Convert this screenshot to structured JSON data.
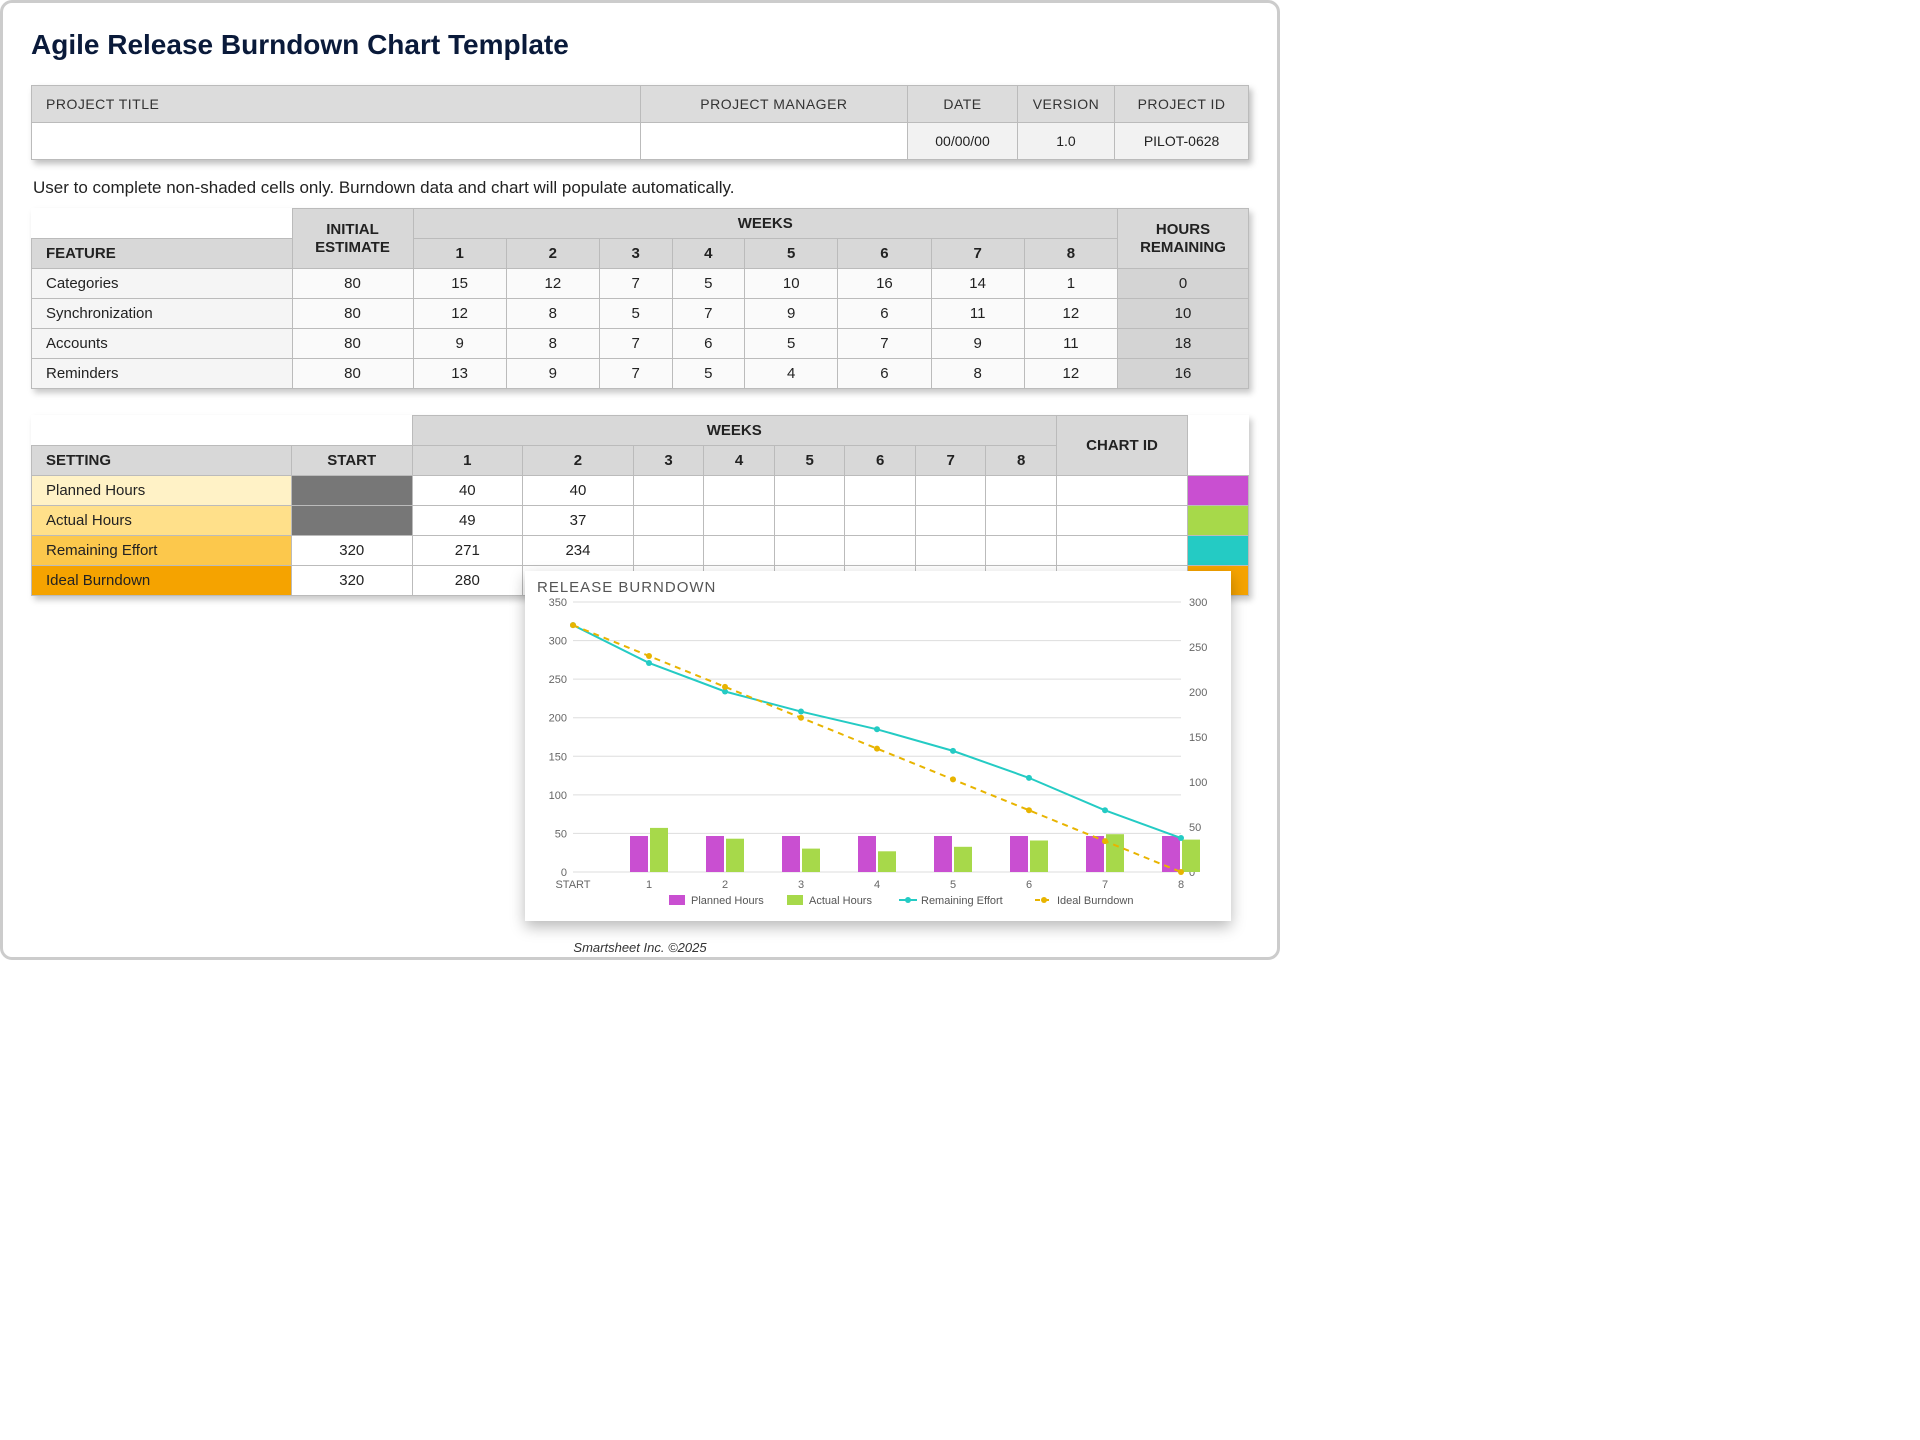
{
  "title": "Agile Release Burndown Chart Template",
  "project_header": {
    "cols": [
      "PROJECT TITLE",
      "PROJECT MANAGER",
      "DATE",
      "VERSION",
      "PROJECT ID"
    ],
    "values": {
      "title": "",
      "manager": "",
      "date": "00/00/00",
      "version": "1.0",
      "id": "PILOT-0628"
    }
  },
  "note": "User to complete non-shaded cells only.  Burndown data and chart will populate automatically.",
  "feature_table": {
    "headers": {
      "feature": "FEATURE",
      "initial": "INITIAL ESTIMATE",
      "weeks": "WEEKS",
      "remain": "HOURS REMAINING"
    },
    "week_labels": [
      "1",
      "2",
      "3",
      "4",
      "5",
      "6",
      "7",
      "8"
    ],
    "rows": [
      {
        "name": "Categories",
        "initial": 80,
        "weeks": [
          15,
          12,
          7,
          5,
          10,
          16,
          14,
          1
        ],
        "remain": 0
      },
      {
        "name": "Synchronization",
        "initial": 80,
        "weeks": [
          12,
          8,
          5,
          7,
          9,
          6,
          11,
          12
        ],
        "remain": 10
      },
      {
        "name": "Accounts",
        "initial": 80,
        "weeks": [
          9,
          8,
          7,
          6,
          5,
          7,
          9,
          11
        ],
        "remain": 18
      },
      {
        "name": "Reminders",
        "initial": 80,
        "weeks": [
          13,
          9,
          7,
          5,
          4,
          6,
          8,
          12
        ],
        "remain": 16
      }
    ]
  },
  "settings_table": {
    "headers": {
      "setting": "SETTING",
      "start": "START",
      "weeks": "WEEKS",
      "chartid": "CHART ID"
    },
    "week_labels": [
      "1",
      "2",
      "3",
      "4",
      "5",
      "6",
      "7",
      "8"
    ],
    "rows": [
      {
        "name": "Planned Hours",
        "start": "",
        "weeks": [
          "40",
          "40",
          "",
          "",
          "",
          "",
          "",
          "",
          ""
        ],
        "swatch": "planned"
      },
      {
        "name": "Actual Hours",
        "start": "",
        "weeks": [
          "49",
          "37",
          "",
          "",
          "",
          "",
          "",
          "",
          ""
        ],
        "swatch": "actual"
      },
      {
        "name": "Remaining Effort",
        "start": "320",
        "weeks": [
          "271",
          "234",
          "",
          "",
          "",
          "",
          "",
          "",
          ""
        ],
        "swatch": "remain"
      },
      {
        "name": "Ideal Burndown",
        "start": "320",
        "weeks": [
          "280",
          "240",
          "",
          "",
          "",
          "",
          "",
          "",
          ""
        ],
        "swatch": "ideal"
      }
    ]
  },
  "chart_data": {
    "type": "combo",
    "title": "RELEASE BURNDOWN",
    "categories": [
      "START",
      "1",
      "2",
      "3",
      "4",
      "5",
      "6",
      "7",
      "8"
    ],
    "left_axis": {
      "min": 0,
      "max": 350,
      "ticks": [
        0,
        50,
        100,
        150,
        200,
        250,
        300,
        350
      ]
    },
    "right_axis": {
      "min": 0,
      "max": 300,
      "ticks": [
        0,
        50,
        100,
        150,
        200,
        250,
        300
      ]
    },
    "series": [
      {
        "name": "Planned Hours",
        "type": "bar",
        "axis": "right",
        "color": "#c94fd1",
        "values": [
          null,
          40,
          40,
          40,
          40,
          40,
          40,
          40,
          40
        ]
      },
      {
        "name": "Actual Hours",
        "type": "bar",
        "axis": "right",
        "color": "#a7d94a",
        "values": [
          null,
          49,
          37,
          26,
          23,
          28,
          35,
          42,
          36
        ]
      },
      {
        "name": "Remaining Effort",
        "type": "line",
        "axis": "left",
        "color": "#24cbc4",
        "style": "solid",
        "values": [
          320,
          271,
          234,
          208,
          185,
          157,
          122,
          80,
          44
        ]
      },
      {
        "name": "Ideal Burndown",
        "type": "line",
        "axis": "left",
        "color": "#e8b400",
        "style": "dashed",
        "values": [
          320,
          280,
          240,
          200,
          160,
          120,
          80,
          40,
          0
        ]
      }
    ],
    "legend": [
      "Planned Hours",
      "Actual Hours",
      "Remaining Effort",
      "Ideal Burndown"
    ]
  },
  "footer": "Smartsheet Inc. ©2025"
}
